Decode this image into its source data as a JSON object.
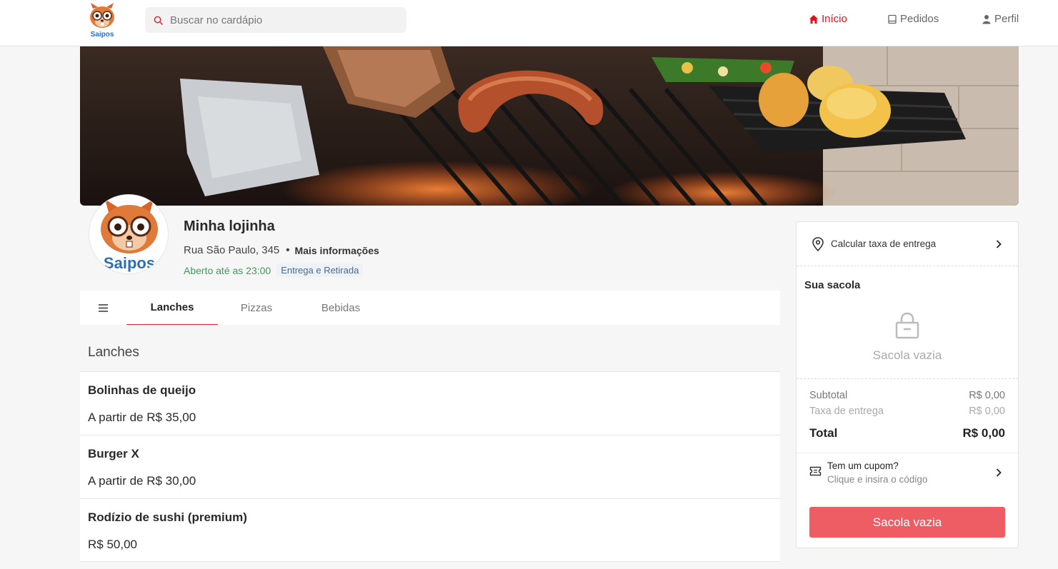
{
  "header": {
    "logo_text": "Saipos",
    "search_placeholder": "Buscar no cardápio",
    "nav": {
      "home": "Início",
      "orders": "Pedidos",
      "profile": "Perfil"
    }
  },
  "store": {
    "logo_text": "Saipos",
    "name": "Minha lojinha",
    "address": "Rua São Paulo, 345",
    "separator": "•",
    "more_info": "Mais informações",
    "status": "Aberto até as 23:00",
    "mode_badge": "Entrega e Retirada"
  },
  "tabs": [
    "Lanches",
    "Pizzas",
    "Bebidas"
  ],
  "section": {
    "title": "Lanches",
    "items": [
      {
        "name": "Bolinhas de queijo",
        "price": "A partir de R$ 35,00"
      },
      {
        "name": "Burger X",
        "price": "A partir de R$ 30,00"
      },
      {
        "name": "Rodízio de sushi (premium)",
        "price": "R$ 50,00"
      }
    ]
  },
  "cart": {
    "delivery_label": "Calcular taxa de entrega",
    "bag_title": "Sua sacola",
    "empty_text": "Sacola vazia",
    "subtotal_label": "Subtotal",
    "subtotal_value": "R$ 0,00",
    "tax_label": "Taxa de entrega",
    "tax_value": "R$ 0,00",
    "total_label": "Total",
    "total_value": "R$ 0,00",
    "coupon_title": "Tem um cupom?",
    "coupon_subtitle": "Clique e insira o código",
    "button_label": "Sacola vazia"
  },
  "colors": {
    "accent": "#e0121b",
    "button": "#ef5d64",
    "open_status": "#3f9a5c"
  }
}
